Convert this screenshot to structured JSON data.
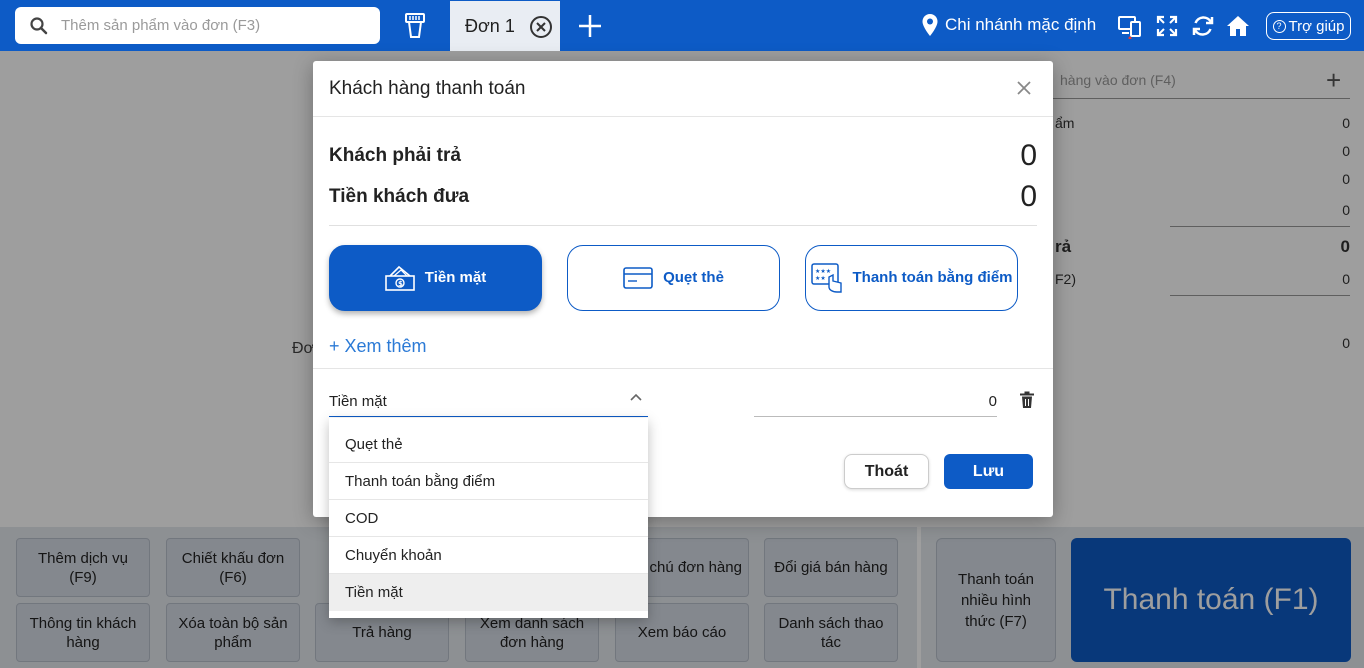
{
  "topbar": {
    "search_placeholder": "Thêm sản phẩm vào đơn (F3)",
    "tab_label": "Đơn 1",
    "branch": "Chi nhánh mặc định",
    "help": "Trợ giúp"
  },
  "right_panel": {
    "search_placeholder": "hàng vào đơn (F4)",
    "rows": [
      {
        "label": "ẩm",
        "value": "0"
      },
      {
        "label": "",
        "value": "0"
      },
      {
        "label": "",
        "value": "0"
      },
      {
        "label": "",
        "value": "0"
      },
      {
        "label": "rả",
        "value": "0"
      },
      {
        "label": "F2)",
        "value": "0"
      },
      {
        "label": "",
        "value": "0"
      }
    ]
  },
  "left_panel": {
    "empty_fragment": "Đơ"
  },
  "function_buttons": [
    "Thêm dịch vụ (F9)",
    "Chiết khấu đơn (F6)",
    "Ghi chú đơn hàng",
    "Đổi giá bán hàng",
    "Thông tin khách hàng",
    "Xóa toàn bộ sản phẩm",
    "Trả hàng",
    "Xem danh sách đơn hàng",
    "Xem báo cáo",
    "Danh sách thao tác"
  ],
  "pay_panel": {
    "multi": "Thanh toán nhiều hình thức (F7)",
    "pay": "Thanh toán (F1)"
  },
  "modal": {
    "title": "Khách hàng thanh toán",
    "due_label": "Khách phải trả",
    "due_value": "0",
    "given_label": "Tiền khách đưa",
    "given_value": "0",
    "methods": [
      {
        "label": "Tiền mặt",
        "icon": "cash-icon"
      },
      {
        "label": "Quẹt thẻ",
        "icon": "card-icon"
      },
      {
        "label": "Thanh toán bằng điểm",
        "icon": "points-icon"
      }
    ],
    "see_more": "+ Xem thêm",
    "selected_method": "Tiền mặt",
    "amount": "0",
    "exit": "Thoát",
    "save": "Lưu"
  },
  "dropdown": {
    "options": [
      "Quẹt thẻ",
      "Thanh toán bằng điểm",
      "COD",
      "Chuyển khoản",
      "Tiền mặt"
    ],
    "selected": "Tiền mặt"
  },
  "colors": {
    "primary": "#0d5bc6",
    "link": "#2b7ad6"
  }
}
